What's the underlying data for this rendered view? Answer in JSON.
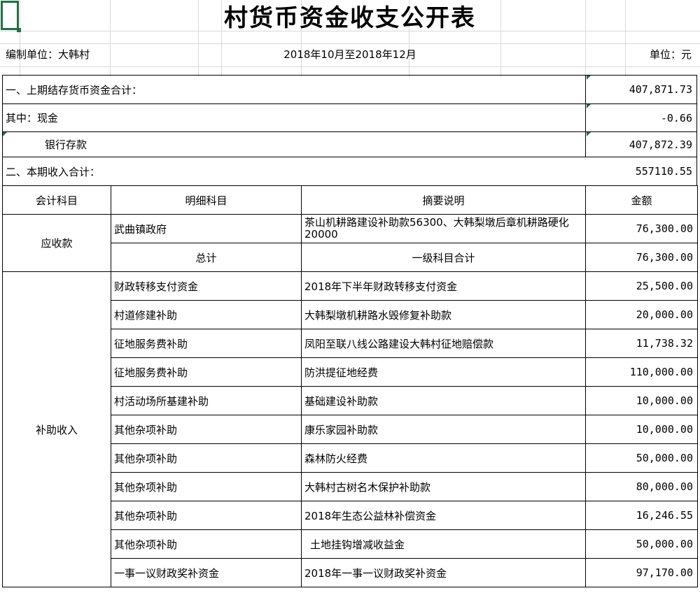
{
  "title": "村货币资金收支公开表",
  "meta": {
    "unit_prepared": "编制单位：大韩村",
    "period": "2018年10月至2018年12月",
    "currency_unit": "单位：元"
  },
  "summary": [
    {
      "label": "一、上期结存货币资金合计：",
      "value": "407,871.73"
    },
    {
      "label": "其中：现金",
      "value": "-0.66"
    },
    {
      "label": "银行存款",
      "value": "407,872.39"
    },
    {
      "label": "二、本期收入合计：",
      "value": "557110.55"
    }
  ],
  "table": {
    "headers": [
      "会计科目",
      "明细科目",
      "摘要说明",
      "金额"
    ],
    "receivable": {
      "account": "应收款",
      "rows": [
        {
          "detail": "武曲镇政府",
          "desc": "茶山机耕路建设补助款56300、大韩梨墩后章机耕路硬化20000",
          "amount": "76,300.00"
        },
        {
          "detail": "总计",
          "desc": "一级科目合计",
          "amount": "76,300.00"
        }
      ]
    },
    "subsidy": {
      "account": "补助收入",
      "rows": [
        {
          "detail": "财政转移支付资金",
          "desc": "2018年下半年财政转移支付资金",
          "amount": "25,500.00"
        },
        {
          "detail": "村道修建补助",
          "desc": "大韩梨墩机耕路水毁修复补助款",
          "amount": "20,000.00"
        },
        {
          "detail": "征地服务费补助",
          "desc": "凤阳至联八线公路建设大韩村征地赔偿款",
          "amount": "11,738.32"
        },
        {
          "detail": "征地服务费补助",
          "desc": "防洪提征地经费",
          "amount": "110,000.00"
        },
        {
          "detail": "村活动场所基建补助",
          "desc": "基础建设补助款",
          "amount": "10,000.00"
        },
        {
          "detail": "其他杂项补助",
          "desc": "康乐家园补助款",
          "amount": "10,000.00"
        },
        {
          "detail": "其他杂项补助",
          "desc": "森林防火经费",
          "amount": "50,000.00"
        },
        {
          "detail": "其他杂项补助",
          "desc": "大韩村古树名木保护补助款",
          "amount": "80,000.00"
        },
        {
          "detail": "其他杂项补助",
          "desc": "2018年生态公益林补偿资金",
          "amount": "16,246.55"
        },
        {
          "detail": "其他杂项补助",
          "desc": "土地挂钩增减收益金",
          "amount": "50,000.00"
        },
        {
          "detail": "一事一议财政奖补资金",
          "desc": "2018年一事一议财政奖补资金",
          "amount": "97,170.00"
        }
      ]
    }
  },
  "colors": {
    "selection": "#1e7145",
    "gridline": "#d9d9d9",
    "border": "#000000"
  }
}
